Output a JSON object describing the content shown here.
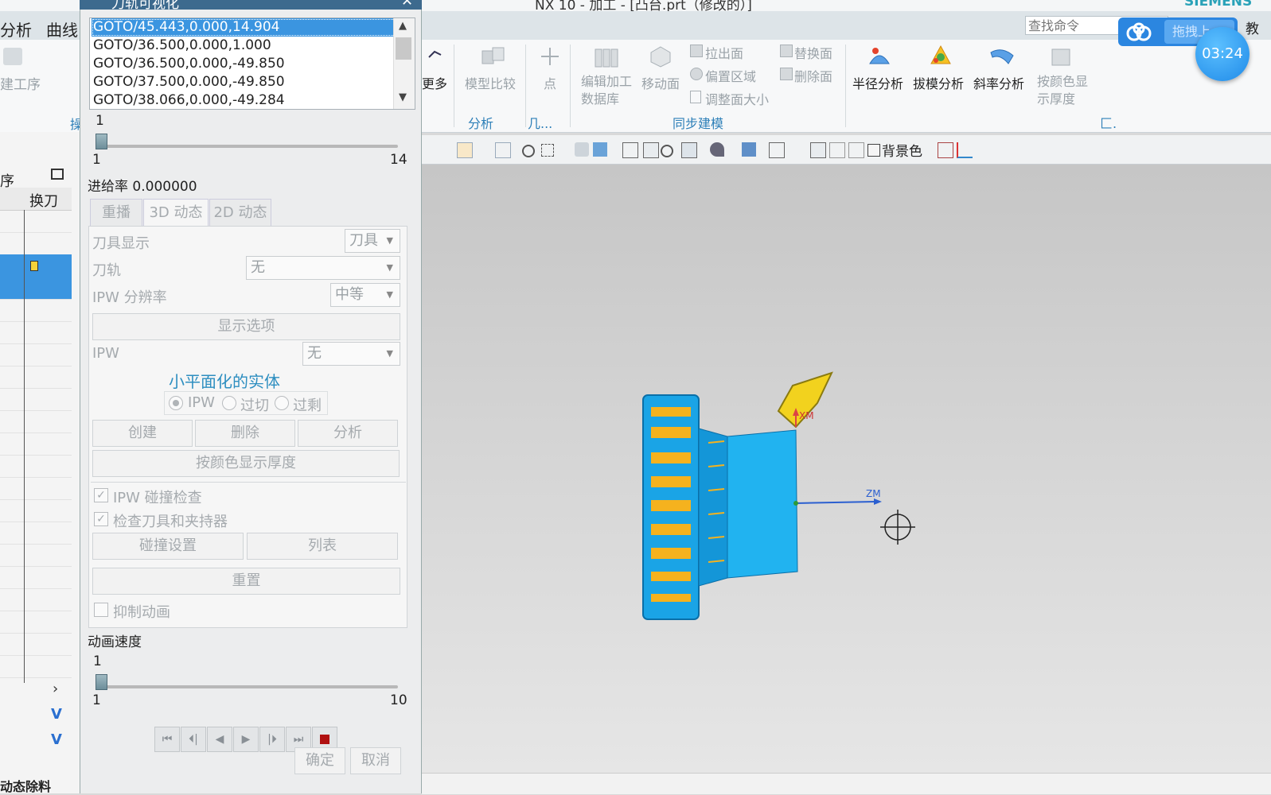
{
  "window": {
    "title": "NX 10 - 加工 - [凸台.prt（修改的）]",
    "brand": "SIEMENS",
    "edge_right": "教"
  },
  "menu": {
    "items": [
      "分析",
      "曲线"
    ]
  },
  "search": {
    "placeholder": "查找命令"
  },
  "cloud": {
    "drag_label": "拖拽上",
    "timer": "03:24"
  },
  "ribbon": {
    "left_label": "建工序",
    "left_group": "操",
    "more": "更多",
    "model_compare": "模型比较",
    "point": "点",
    "analysis_group": "分析",
    "geometry_group": "几...",
    "edit_db": "编辑加工\n数据库",
    "move_face": "移动面",
    "pull_face": "拉出面",
    "offset_region": "偏置区域",
    "resize_face": "调整面大小",
    "replace_face": "替换面",
    "delete_face": "删除面",
    "sync_group": "同步建模",
    "radius_analysis": "半径分析",
    "draft_analysis": "拔模分析",
    "slope_analysis": "斜率分析",
    "color_thickness": "按颜色显\n示厚度",
    "last_group": "匚."
  },
  "toolbar": {
    "background_color": "背景色"
  },
  "navigator": {
    "header_left": "序",
    "col_tool_change": "换刀",
    "bottom_label": "动态除料"
  },
  "dialog": {
    "title": "刀轨可视化",
    "goto_list": [
      "GOTO/45.443,0.000,14.904",
      "GOTO/36.500,0.000,1.000",
      "GOTO/36.500,0.000,-49.850",
      "GOTO/37.500,0.000,-49.850",
      "GOTO/38.066,0.000,-49.284"
    ],
    "selected_index": 0,
    "step_slider": {
      "value": "1",
      "min": "1",
      "max": "14"
    },
    "feed_rate": "进给率 0.000000",
    "tabs": [
      "重播",
      "3D 动态",
      "2D 动态"
    ],
    "active_tab": "3D 动态",
    "tool_display_label": "刀具显示",
    "tool_display_value": "刀具",
    "toolpath_label": "刀轨",
    "toolpath_value": "无",
    "ipw_res_label": "IPW 分辨率",
    "ipw_res_value": "中等",
    "display_options": "显示选项",
    "ipw_label": "IPW",
    "ipw_value": "无",
    "facet_title": "小平面化的实体",
    "radio_ipw": "IPW",
    "radio_overcut": "过切",
    "radio_excess": "过剩",
    "create": "创建",
    "delete": "删除",
    "analyze": "分析",
    "thickness_by_color": "按颜色显示厚度",
    "ipw_collision": "IPW 碰撞检查",
    "check_tool_holder": "检查刀具和夹持器",
    "collision_settings": "碰撞设置",
    "list": "列表",
    "reset": "重置",
    "suppress_animation": "抑制动画",
    "anim_speed_label": "动画速度",
    "speed_slider": {
      "value": "1",
      "min": "1",
      "max": "10"
    },
    "ok": "确定",
    "cancel": "取消"
  },
  "viewport": {
    "axis_xm": "XM",
    "axis_zm": "ZM",
    "colors": {
      "part_blue": "#1aa4e6",
      "stripe_orange": "#f5b21e",
      "tool_yellow": "#f2d21e"
    }
  }
}
